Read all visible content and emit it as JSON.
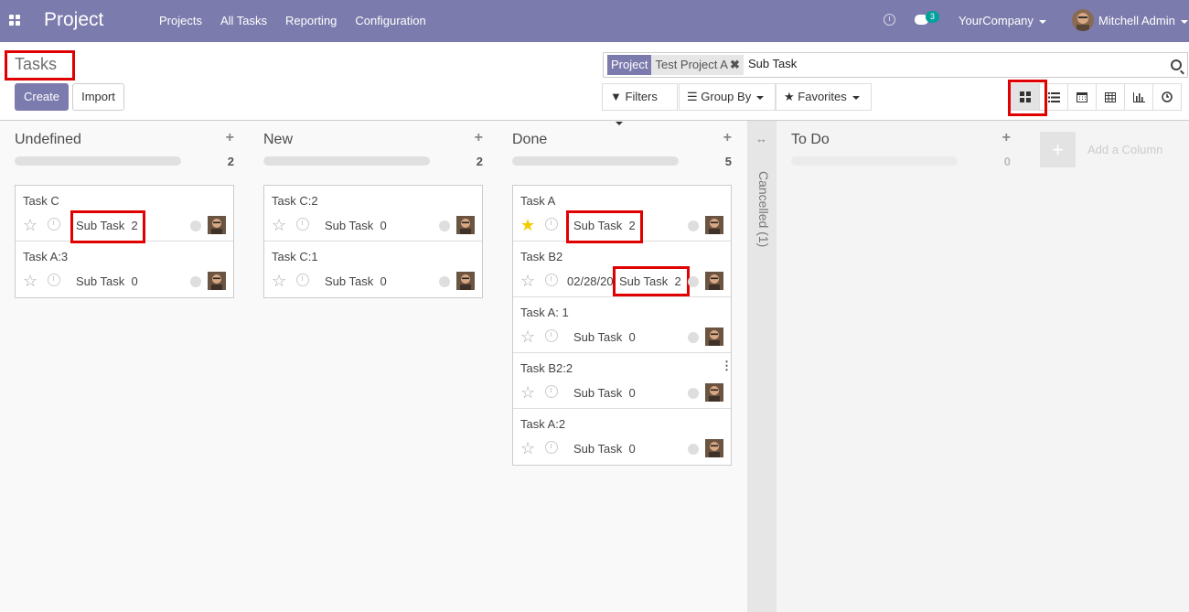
{
  "navbar": {
    "brand": "Project",
    "menu": [
      "Projects",
      "All Tasks",
      "Reporting",
      "Configuration"
    ],
    "chat_count": "3",
    "company": "YourCompany",
    "user": "Mitchell Admin"
  },
  "control": {
    "breadcrumb": "Tasks",
    "create_label": "Create",
    "import_label": "Import",
    "search_facet_label": "Project",
    "search_facet_value": "Test Project A",
    "search_text": "Sub Task",
    "filters_label": "Filters",
    "groupby_label": "Group By",
    "favorites_label": "Favorites",
    "views": [
      "kanban",
      "list",
      "calendar",
      "pivot",
      "graph",
      "activity"
    ],
    "active_view": "kanban"
  },
  "columns": [
    {
      "title": "Undefined",
      "count": "2",
      "cards": [
        {
          "title": "Task C",
          "subtask_label": "Sub Task",
          "subtask_count": "2",
          "starred": false,
          "highlight": true
        },
        {
          "title": "Task A:3",
          "subtask_label": "Sub Task",
          "subtask_count": "0",
          "starred": false
        }
      ]
    },
    {
      "title": "New",
      "count": "2",
      "cards": [
        {
          "title": "Task C:2",
          "subtask_label": "Sub Task",
          "subtask_count": "0",
          "starred": false
        },
        {
          "title": "Task C:1",
          "subtask_label": "Sub Task",
          "subtask_count": "0",
          "starred": false
        }
      ]
    },
    {
      "title": "Done",
      "count": "5",
      "cards": [
        {
          "title": "Task A",
          "subtask_label": "Sub Task",
          "subtask_count": "2",
          "starred": true,
          "highlight": true
        },
        {
          "title": "Task B2",
          "date": "02/28/20",
          "subtask_label": "Sub Task",
          "subtask_count": "2",
          "starred": false,
          "highlight": true
        },
        {
          "title": "Task A: 1",
          "subtask_label": "Sub Task",
          "subtask_count": "0",
          "starred": false
        },
        {
          "title": "Task B2:2",
          "subtask_label": "Sub Task",
          "subtask_count": "0",
          "starred": false,
          "kebab": true
        },
        {
          "title": "Task A:2",
          "subtask_label": "Sub Task",
          "subtask_count": "0",
          "starred": false
        }
      ]
    }
  ],
  "folded_column": {
    "label": "Cancelled (1)"
  },
  "todo_column": {
    "title": "To Do",
    "count": "0"
  },
  "add_column_label": "Add a Column",
  "colors": {
    "brand": "#7c7bad",
    "highlight": "#e00000",
    "star_on": "#f3cc00"
  }
}
